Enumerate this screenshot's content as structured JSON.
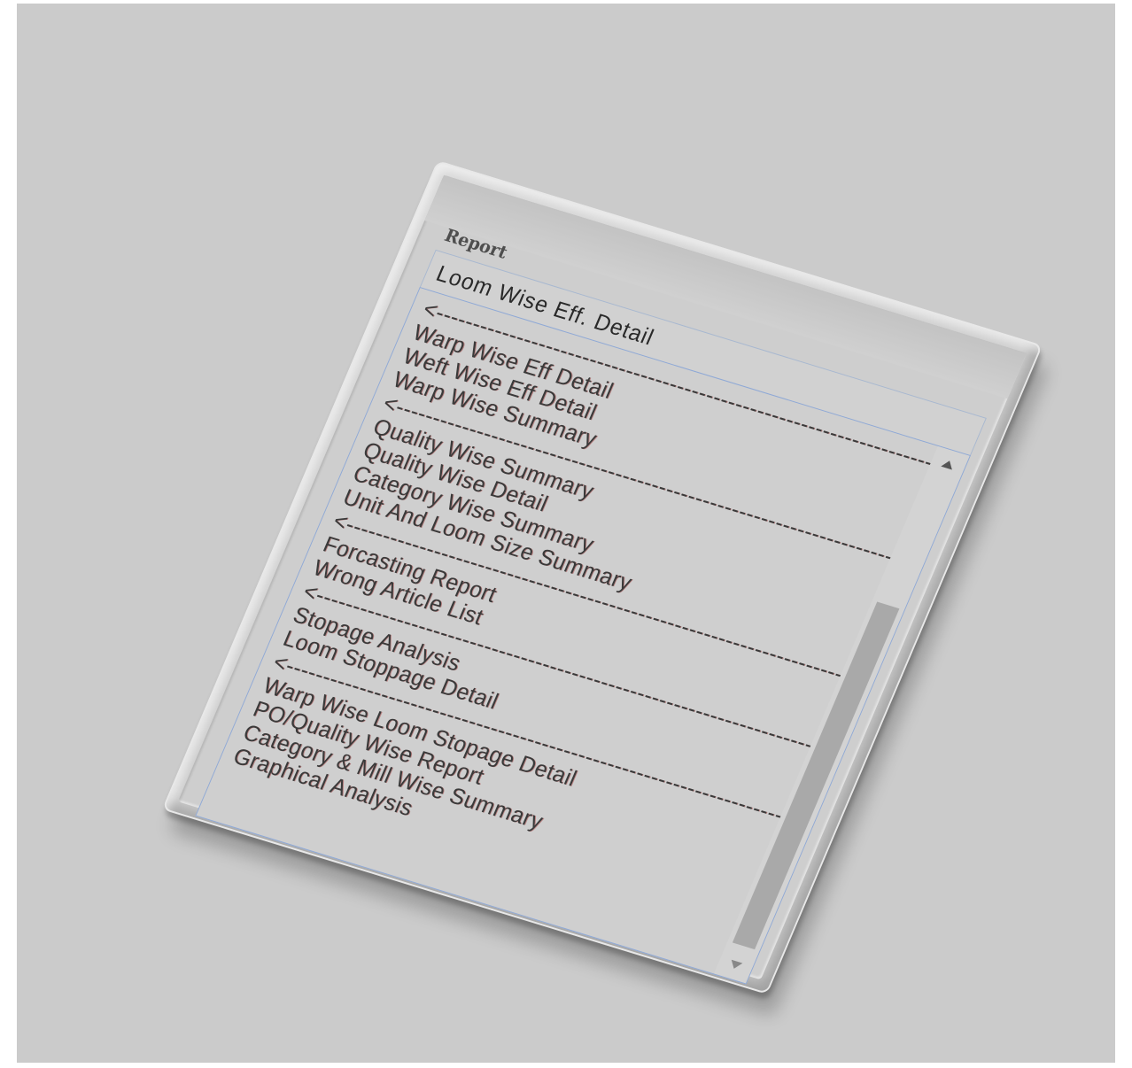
{
  "form": {
    "label": "Report",
    "selected_value": "Loom Wise Eff. Detail"
  },
  "options": [
    "<----------------------------------------------------------------------------------->",
    "Warp Wise Eff Detail",
    "Weft Wise Eff Detail",
    "Warp Wise Summary",
    "<----------------------------------------------------------------------------------->",
    "Quality Wise Summary",
    "Quality Wise Detail",
    "Category Wise Summary",
    "Unit And Loom Size Summary",
    "<----------------------------------------------------------------------------------->",
    "Forcasting Report",
    "Wrong Article List",
    "<----------------------------------------------------------------------------------->",
    "Stopage Analysis",
    "Loom Stoppage Detail",
    "<----------------------------------------------------------------------------------->",
    "Warp Wise Loom Stopage Detail",
    "PO/Quality Wise Report",
    "Category & Mill Wise Summary",
    "Graphical Analysis"
  ],
  "icons": {
    "dropdown": "chevron-down-icon",
    "scroll_up": "scroll-up-icon",
    "scroll_down": "scroll-down-icon"
  },
  "colors": {
    "background": "#cbcbcb",
    "listbox_border": "#8fa9d6",
    "scroll_thumb": "#a9a9a9"
  }
}
